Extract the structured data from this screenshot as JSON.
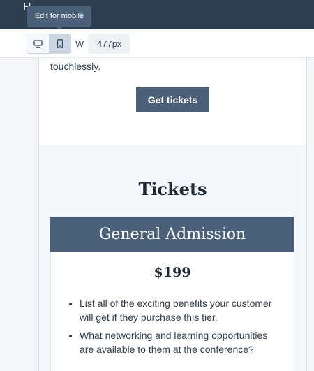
{
  "topbar": {
    "tooltip_text": "Edit for mobile"
  },
  "toolbar": {
    "width_label": "W",
    "width_value": "477px"
  },
  "content": {
    "intro_text": "touchlessly.",
    "cta_label": "Get tickets",
    "tickets_heading": "Tickets",
    "tier": {
      "name": "General Admission",
      "price": "$199",
      "benefits": [
        "List all of the exciting benefits your customer will get if they purchase this tier.",
        "What networking and learning opportunities are available to them at the conference?"
      ]
    }
  },
  "colors": {
    "topbar_bg": "#2d3e50",
    "accent": "#4a6179"
  },
  "icons": {
    "desktop": "desktop-icon",
    "mobile": "mobile-icon"
  }
}
